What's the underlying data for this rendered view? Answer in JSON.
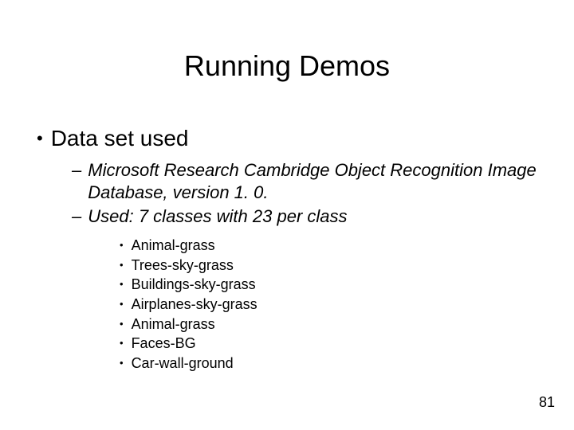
{
  "title": "Running Demos",
  "level1": {
    "bullet": "•",
    "text": "Data set used"
  },
  "level2": [
    {
      "dash": "–",
      "text": "Microsoft Research Cambridge Object Recognition Image Database, version 1. 0."
    },
    {
      "dash": "–",
      "text": "Used: 7 classes with 23 per class"
    }
  ],
  "level3": [
    {
      "dot": "•",
      "text": "Animal-grass"
    },
    {
      "dot": "•",
      "text": "Trees-sky-grass"
    },
    {
      "dot": "•",
      "text": "Buildings-sky-grass"
    },
    {
      "dot": "•",
      "text": "Airplanes-sky-grass"
    },
    {
      "dot": "•",
      "text": "Animal-grass"
    },
    {
      "dot": "•",
      "text": "Faces-BG"
    },
    {
      "dot": "•",
      "text": "Car-wall-ground"
    }
  ],
  "page_number": "81"
}
